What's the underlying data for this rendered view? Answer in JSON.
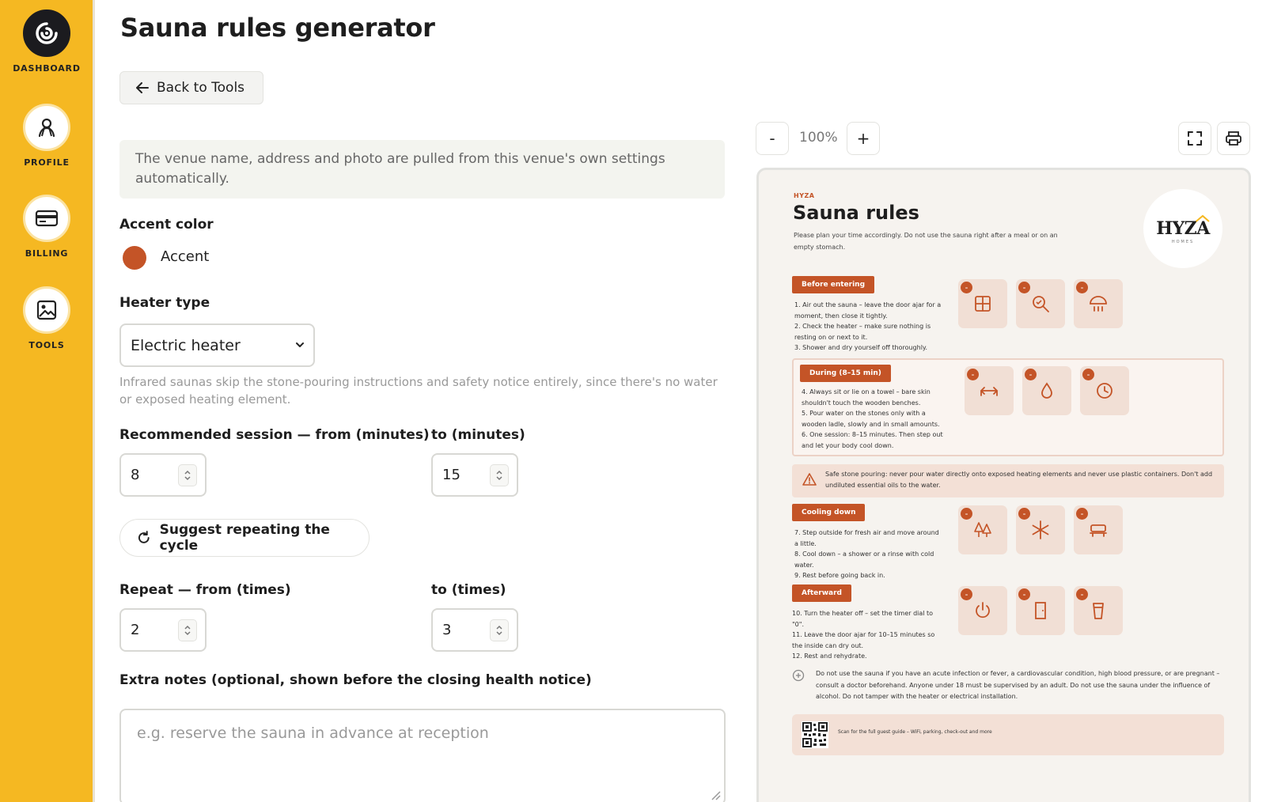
{
  "sidebar": {
    "items": [
      {
        "label": "DASHBOARD",
        "icon": "dashboard-logo-icon"
      },
      {
        "label": "PROFILE",
        "icon": "user-icon"
      },
      {
        "label": "BILLING",
        "icon": "credit-card-icon"
      },
      {
        "label": "TOOLS",
        "icon": "image-icon"
      }
    ]
  },
  "header": {
    "title": "Sauna rules generator",
    "back_label": "Back to Tools"
  },
  "form": {
    "info_text": "The venue name, address and photo are pulled from this venue's own settings automatically.",
    "accent_label": "Accent color",
    "accent_name": "Accent",
    "accent_color": "#c45427",
    "heater_label": "Heater type",
    "heater_value": "Electric heater",
    "heater_hint": "Infrared saunas skip the stone-pouring instructions and safety notice entirely, since there's no water or exposed heating element.",
    "session_from_label": "Recommended session — from (minutes)",
    "session_to_label": "to (minutes)",
    "session_from": "8",
    "session_to": "15",
    "suggest_label": "Suggest repeating the cycle",
    "repeat_from_label": "Repeat — from (times)",
    "repeat_to_label": "to (times)",
    "repeat_from": "2",
    "repeat_to": "3",
    "notes_label": "Extra notes (optional, shown before the closing health notice)",
    "notes_placeholder": "e.g. reserve the sauna in advance at reception"
  },
  "toolbar": {
    "zoom_out": "-",
    "zoom_level": "100%",
    "zoom_in": "+"
  },
  "preview": {
    "brand_small": "HYZA",
    "title": "Sauna rules",
    "subtitle": "Please plan your time accordingly. Do not use the sauna right after a meal or on an empty stomach.",
    "logo_text": "HYZA",
    "logo_small": "HOMES",
    "sections": [
      {
        "tag": "Before entering",
        "items": [
          "1. Air out the sauna – leave the door ajar for a moment, then close it tightly.",
          "2. Check the heater – make sure nothing is resting on or next to it.",
          "3. Shower and dry yourself off thoroughly."
        ]
      },
      {
        "tag": "During (8–15 min)",
        "items": [
          "4. Always sit or lie on a towel – bare skin shouldn't touch the wooden benches.",
          "5. Pour water on the stones only with a wooden ladle, slowly and in small amounts.",
          "6. One session: 8–15 minutes. Then step out and let your body cool down."
        ]
      },
      {
        "tag": "Cooling down",
        "items": [
          "7. Step outside for fresh air and move around a little.",
          "8. Cool down – a shower or a rinse with cold water.",
          "9. Rest before going back in."
        ]
      },
      {
        "tag": "Afterward",
        "items": [
          "10. Turn the heater off – set the timer dial to \"0\".",
          "11. Leave the door ajar for 10–15 minutes so the inside can dry out.",
          "12. Rest and rehydrate."
        ]
      }
    ],
    "warning": "Safe stone pouring: never pour water directly onto exposed heating elements and never use plastic containers. Don't add undiluted essential oils to the water.",
    "health": "Do not use the sauna if you have an acute infection or fever, a cardiovascular condition, high blood pressure, or are pregnant – consult a doctor beforehand. Anyone under 18 must be supervised by an adult. Do not use the sauna under the influence of alcohol. Do not tamper with the heater or electrical installation.",
    "qr_text": "Scan for the full guest guide – WiFi, parking, check-out and more",
    "accent": "#c45427"
  }
}
